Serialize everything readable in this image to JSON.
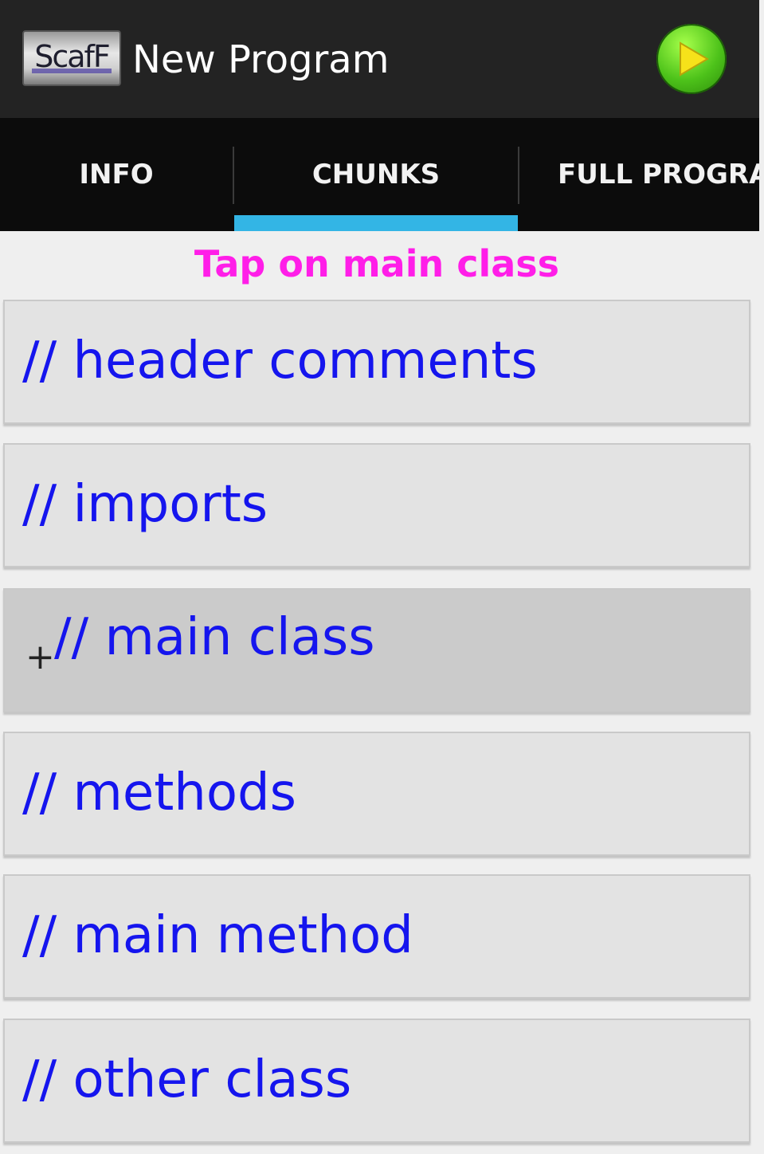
{
  "action_bar": {
    "logo_text": "ScafF",
    "title": "New Program",
    "run_icon": "play-icon"
  },
  "tabs": [
    {
      "label": "INFO"
    },
    {
      "label": "CHUNKS",
      "selected": true
    },
    {
      "label": "FULL PROGRAM"
    }
  ],
  "hint": "Tap on main class",
  "chunks": [
    {
      "label": "// header comments"
    },
    {
      "label": "// imports"
    },
    {
      "label": "// main class",
      "selected": true,
      "expand_marker": "+"
    },
    {
      "label": "// methods"
    },
    {
      "label": "// main method"
    },
    {
      "label": "// other class"
    }
  ],
  "colors": {
    "action_bar": "#232323",
    "tab_bar": "#0c0c0c",
    "tab_indicator": "#33b5e5",
    "hint": "#ff1ee8",
    "chunk_text": "#1515ee"
  }
}
